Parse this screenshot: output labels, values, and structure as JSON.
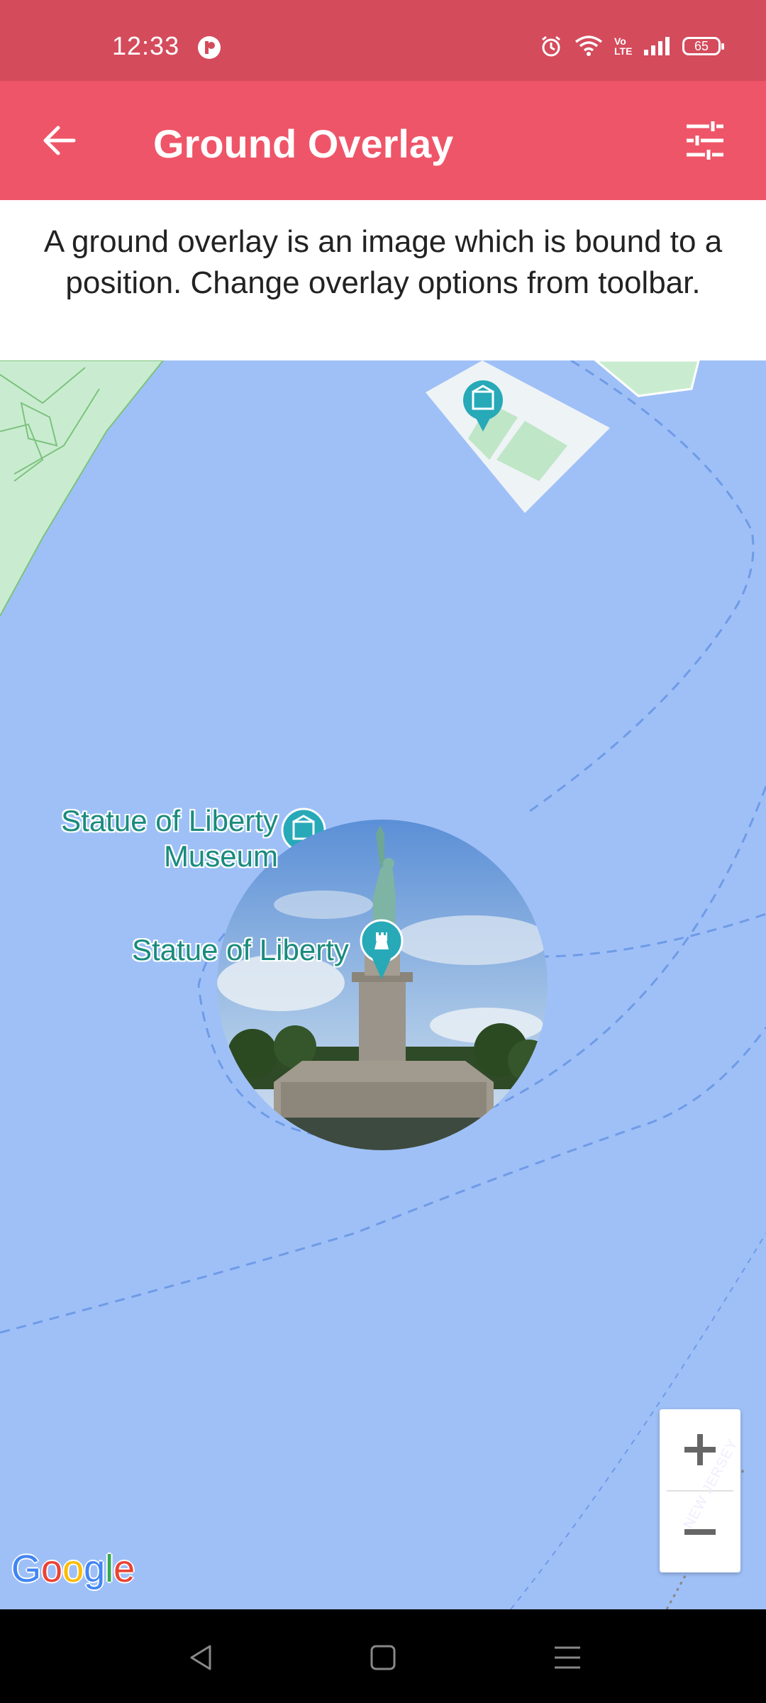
{
  "status": {
    "time": "12:33",
    "battery": "65",
    "volte": "Vo LTE"
  },
  "app_bar": {
    "title": "Ground Overlay",
    "back_icon": "arrow-back-icon",
    "tune_icon": "tune-icon"
  },
  "description": "A ground overlay is an image which is bound to a position. Change overlay options from toolbar.",
  "map": {
    "labels": {
      "museum": "Statue of Liberty Museum",
      "statue": "Statue of Liberty",
      "new_jersey": "NEW JERSEY"
    },
    "zoom_in": "+",
    "zoom_out": "−",
    "attribution": "Google",
    "colors": {
      "water": "#9fc0f7",
      "land": "#c9ecd0",
      "pin": "#27a9b8"
    }
  },
  "nav": {
    "back": "back-icon",
    "home": "home-icon",
    "menu": "menu-icon"
  }
}
